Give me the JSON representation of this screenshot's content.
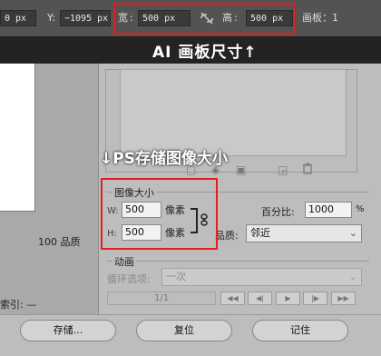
{
  "ai_toolbar": {
    "x_value": "0 px",
    "y_label": "Y:",
    "y_value": "−1095 px",
    "width_label": "宽",
    "width_value": "500 px",
    "height_label": "高",
    "height_value": "500 px",
    "artboard_label": "画板：1",
    "colon": ":"
  },
  "ai_caption": "AI 画板尺寸↑",
  "ps_caption": "↓PS存储图像大小",
  "left_panel": {
    "quality_text": "100 品质",
    "index_text": "索引: —"
  },
  "image_size": {
    "group_title": "图像大小",
    "w_label": "W:",
    "w_value": "500",
    "h_label": "H:",
    "h_value": "500",
    "unit_pixels": "像素",
    "percent_label": "百分比:",
    "percent_value": "1000",
    "percent_sign": "%",
    "quality_label": "品质:",
    "quality_value": "邻近"
  },
  "animation": {
    "group_title": "动画",
    "loop_label": "循环选项:",
    "loop_value": "一次",
    "frame_counter": "1/1"
  },
  "buttons": {
    "save": "存储...",
    "reset": "复位",
    "remember": "记住"
  },
  "colors": {
    "highlight_red": "#e41e1e",
    "toolbar_dark": "#535353",
    "caption_bar": "#232323"
  }
}
